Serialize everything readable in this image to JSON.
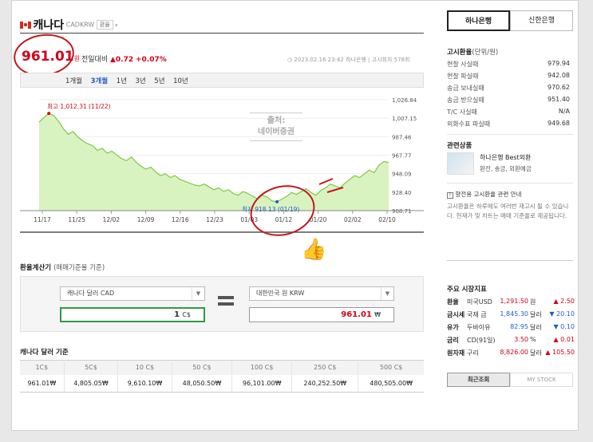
{
  "header": {
    "currency_name": "캐나다",
    "currency_code": "CADKRW",
    "exchange_tag": "환율",
    "rate": "961.01",
    "rate_unit": "원",
    "change_label": "전일대비",
    "change_value": "▲0.72",
    "change_pct": "+0.07%",
    "timestamp": "2023.02.16 23:42",
    "bank": "하나은행",
    "notice_count": "고시회차 578회"
  },
  "bank_tabs": [
    "하나은행",
    "신한은행"
  ],
  "period_tabs": [
    "1개월",
    "3개월",
    "1년",
    "3년",
    "5년",
    "10년"
  ],
  "active_period": "3개월",
  "watermark": [
    "출처:",
    "네이버증권"
  ],
  "chart_data": {
    "type": "area",
    "x_ticks": [
      "11/17",
      "11/25",
      "12/02",
      "12/09",
      "12/16",
      "12/23",
      "01/03",
      "01/12",
      "01/20",
      "02/02",
      "02/10"
    ],
    "y_ticks": [
      "1,026.84",
      "1,007.15",
      "987.46",
      "967.77",
      "948.09",
      "928.40",
      "908.71"
    ],
    "ylim": [
      908.71,
      1026.84
    ],
    "values": [
      1003,
      1008,
      1012.31,
      1010,
      1004,
      996,
      990,
      993,
      987,
      983,
      980,
      978,
      973,
      975,
      970,
      972,
      968,
      964,
      962,
      966,
      960,
      956,
      953,
      955,
      950,
      946,
      948,
      944,
      946,
      942,
      940,
      938,
      936,
      935,
      937,
      934,
      931,
      933,
      929,
      931,
      927,
      925,
      929,
      927,
      924,
      921,
      925,
      923,
      919,
      918.13,
      921,
      924,
      928,
      926,
      929,
      932,
      928,
      925,
      930,
      933,
      937,
      935,
      933,
      938,
      942,
      946,
      944,
      948,
      952,
      949,
      957,
      961,
      960
    ],
    "high_label": "최고 1,012.31 (11/22)",
    "low_label": "최저 918.13 (01/19)",
    "high_index": 2,
    "low_index": 49,
    "line_color": "#7ec843",
    "fill_color": "#d9f3c0"
  },
  "calculator": {
    "title": "환율계산기",
    "subtitle": "(매매기준율 기준)",
    "from_currency": "캐나다 달러 CAD",
    "to_currency": "대한민국 원 KRW",
    "from_amount": "1",
    "from_unit": "C$",
    "to_amount": "961.01",
    "to_unit": "₩"
  },
  "table": {
    "title": "캐나다 달러 기준",
    "headers": [
      "1C$",
      "5C$",
      "10 C$",
      "50 C$",
      "100 C$",
      "250 C$",
      "500 C$"
    ],
    "values": [
      "961.01₩",
      "4,805.05₩",
      "9,610.10₩",
      "48,050.50₩",
      "96,101.00₩",
      "240,252.50₩",
      "480,505.00₩"
    ]
  },
  "notice_rates": {
    "title": "고시환율",
    "unit": "(단위/원)",
    "rows": [
      {
        "label": "현찰 사실때",
        "value": "979.94"
      },
      {
        "label": "현찰 파실때",
        "value": "942.08"
      },
      {
        "label": "송금 보내실때",
        "value": "970.62"
      },
      {
        "label": "송금 받으실때",
        "value": "951.40"
      },
      {
        "label": "T/C 사실때",
        "value": "N/A"
      },
      {
        "label": "외화수표 파실때",
        "value": "949.68"
      }
    ]
  },
  "related": {
    "title": "관련상품",
    "product_name": "하나은행 Best외환",
    "product_desc": "환전, 송금, 외환예금"
  },
  "guide": {
    "title": "향전용 고시환율 관련 안내",
    "body": "고시환율은 하루에도 여러번 재고시 될 수 있습니다. 현재가 및 차트는 매매 기준율로 제공됩니다."
  },
  "market": {
    "title": "주요 시장지표",
    "rows": [
      {
        "cat": "환율",
        "name": "미국USD",
        "value": "1,291.50",
        "unit": "원",
        "change": "▲ 2.50",
        "dir": "up"
      },
      {
        "cat": "금시세",
        "name": "국제 금",
        "value": "1,845.30",
        "unit": "달러",
        "change": "▼ 20.10",
        "dir": "down"
      },
      {
        "cat": "유가",
        "name": "두바이유",
        "value": "82.95",
        "unit": "달러",
        "change": "▼ 0.10",
        "dir": "down"
      },
      {
        "cat": "금리",
        "name": "CD(91일)",
        "value": "3.50",
        "unit": "%",
        "change": "▲ 0.01",
        "dir": "up"
      },
      {
        "cat": "원자재",
        "name": "구리",
        "value": "8,826.00",
        "unit": "달러",
        "change": "▲ 105.50",
        "dir": "up"
      }
    ],
    "tabs": [
      "최근조회",
      "MY STOCK"
    ]
  }
}
